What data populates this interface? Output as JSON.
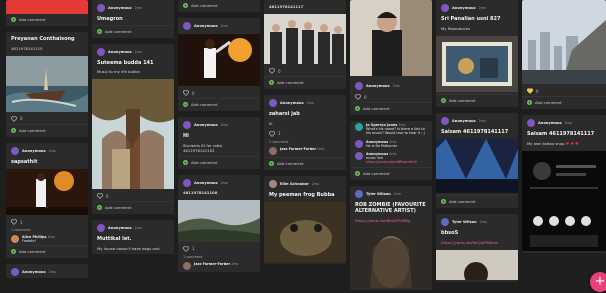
{
  "common": {
    "add_comment": "Add comment",
    "comment_1": "1 comment"
  },
  "col1": {
    "card1": {
      "title": "Preyanan Conthaisong",
      "body": "4611978141115",
      "likes": "0"
    },
    "card2": {
      "user": "Anonymous",
      "time": "2mo",
      "title": "sapsathit",
      "likes": "1",
      "comment_user": "Alice Phillips",
      "comment_time": "2mo",
      "comment_text": "Freddie!"
    },
    "card3": {
      "user": "Anonymous",
      "time": "2mo"
    }
  },
  "col2": {
    "card1": {
      "user": "Anonymous",
      "time": "2mo",
      "title": "Umagron"
    },
    "card2": {
      "user": "Anonymous",
      "time": "2mo",
      "title": "Suteema budda 141",
      "body": "Music to my life  bukka"
    },
    "card3": {
      "likes": "0"
    },
    "card4": {
      "user": "Anonymous",
      "time": "2mo",
      "title": "Muttikal let.",
      "body": "My house doesn't have dogs and"
    }
  },
  "col3": {
    "card1": {
      "user": "Anonymous",
      "time": "2mo",
      "likes": "0"
    },
    "card2": {
      "user": "Anonymous",
      "time": "2mo",
      "title": "Hi",
      "body1": "Students ID for ratta",
      "body2": "4611978141103"
    },
    "card3": {
      "user": "Anonymous",
      "time": "2mo",
      "body": "4611978141108",
      "likes": "1",
      "comment_user": "Jazz Farmer-Farber",
      "comment_time": "2mo"
    }
  },
  "col4": {
    "card1": {
      "body": "4611978141117",
      "likes": "0"
    },
    "card2": {
      "user": "Anonymous",
      "time": "2mo",
      "title": "zaharsi jab",
      "body": "hi",
      "likes": "1",
      "comment_user": "Jazz Farmer-Farber",
      "comment_time": "2mo"
    },
    "card3": {
      "user": "Ellie Schnabor",
      "time": "2mo",
      "title": "My peeman frog Bubba"
    }
  },
  "col5": {
    "card1": {
      "user": "Anonymous",
      "time": "2mo",
      "likes": "0"
    },
    "card2": {
      "user": "Jo Sperryo Jones",
      "time": "2mo",
      "c1": "What's his name? Is there a link to his music? Would love to hear it :-)",
      "user2": "Anonymous",
      "time2": "2mo",
      "c2": "He is Bo Palburner",
      "user3": "Anonymous",
      "time3": "2mo",
      "c3": "music link",
      "c3_link": "https://youtu.be/rqBRqemKQrI"
    },
    "card3": {
      "user": "Tyler Wilson",
      "time": "2mo",
      "title": "ROB ZOMBIE (FAVOURITE ALTERNATIVE ARTIST)",
      "link": "https://youtu.be/6hd4POXBfg"
    }
  },
  "col6": {
    "card1": {
      "user": "Anonymous",
      "time": "2mo",
      "title": "Sri Panalian usni 827",
      "body": "My Reproduces"
    },
    "card2": {
      "user": "Anonymous",
      "time": "2mo",
      "title": "Saisam 4611978141117"
    },
    "card3": {
      "user": "Tyler Wilson",
      "time": "2mo",
      "title": "bbsoS",
      "link": "https://youtu.be/NcQAJRMijew"
    }
  },
  "col7": {
    "card1": {
      "likes": "0"
    },
    "card2": {
      "user": "Anonymous",
      "time": "2mo",
      "title": "Saisam 4611978141117",
      "body": "My own tattoo shop"
    }
  },
  "fab": {
    "label": "+"
  }
}
